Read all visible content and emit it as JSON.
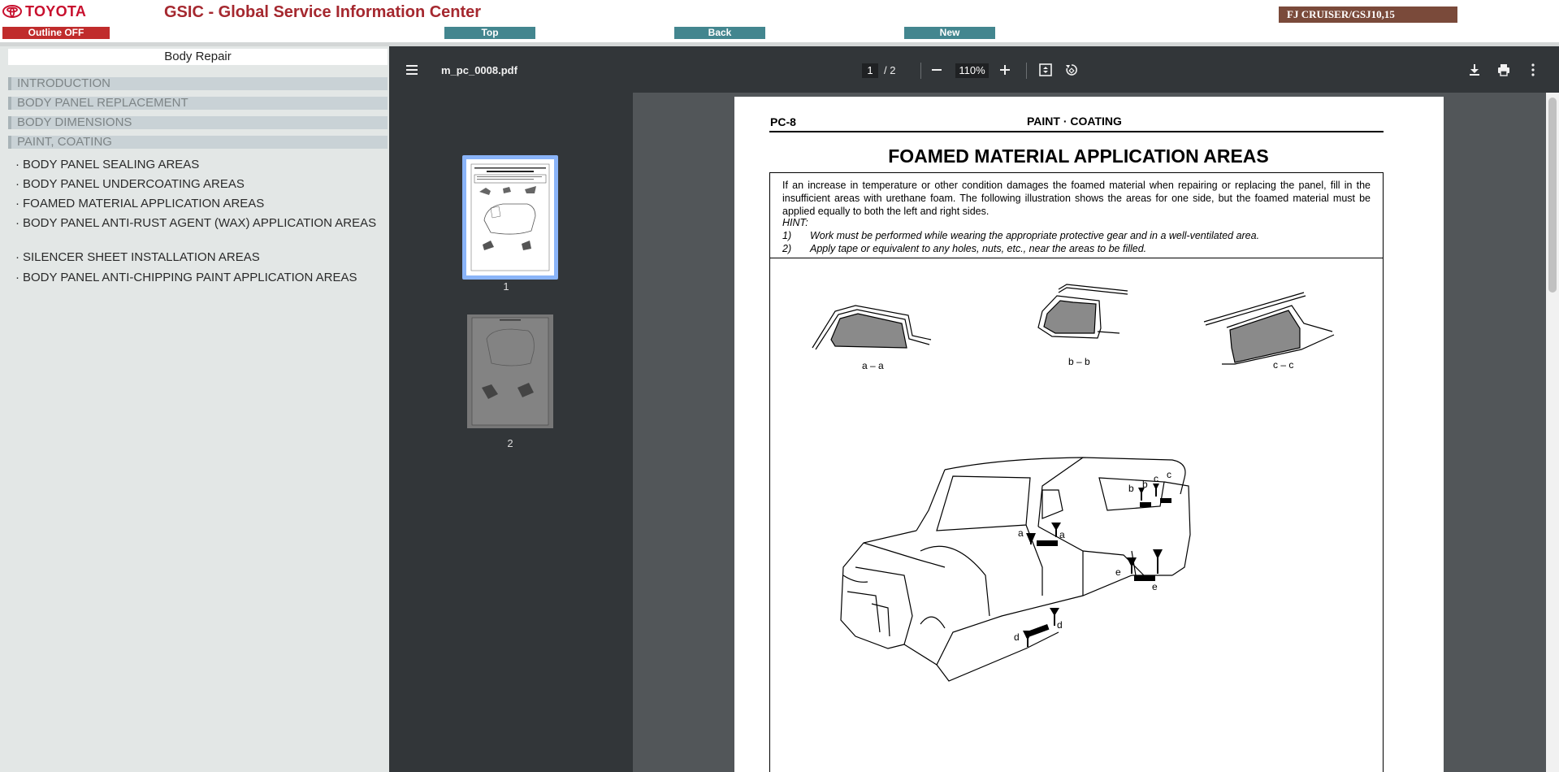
{
  "header": {
    "brand": "TOYOTA",
    "app_title": "GSIC - Global Service Information Center",
    "outline_button": "Outline OFF",
    "nav": {
      "top": "Top",
      "back": "Back",
      "new": "New"
    },
    "model": "FJ CRUISER/GSJ10,15"
  },
  "outline": {
    "section": "Body Repair",
    "categories": [
      "INTRODUCTION",
      "BODY PANEL REPLACEMENT",
      "BODY DIMENSIONS",
      "PAINT, COATING"
    ],
    "items": [
      "BODY PANEL SEALING AREAS",
      "BODY PANEL UNDERCOATING AREAS",
      "FOAMED MATERIAL APPLICATION AREAS",
      "BODY PANEL ANTI-RUST AGENT (WAX) APPLICATION AREAS",
      "SILENCER SHEET INSTALLATION AREAS",
      "BODY PANEL ANTI-CHIPPING PAINT APPLICATION AREAS"
    ],
    "bullet": "·"
  },
  "viewer": {
    "filename": "m_pc_0008.pdf",
    "page_current": "1",
    "page_total": "/ 2",
    "zoom": "110%",
    "thumb_labels": [
      "1",
      "2"
    ],
    "icons": [
      "menu-icon",
      "zoom-out-icon",
      "zoom-in-icon",
      "fit-page-icon",
      "rotate-icon",
      "download-icon",
      "print-icon",
      "more-icon"
    ]
  },
  "document": {
    "code": "PC-8",
    "header": "PAINT · COATING",
    "title": "FOAMED MATERIAL APPLICATION AREAS",
    "note": "If an increase in temperature or other condition damages the foamed material when repairing or replacing the panel, fill in the insufficient areas with urethane foam. The following illustration shows the areas for one side, but the foamed material must be applied equally to both the left and right sides.",
    "hint": "HINT:",
    "steps": [
      {
        "num": "1)",
        "text": "Work must be performed while wearing the appropriate protective gear and in a well-ventilated area."
      },
      {
        "num": "2)",
        "text": "Apply tape or equivalent to any holes, nuts, etc., near the areas to be filled."
      }
    ],
    "section_labels": [
      "a – a",
      "b – b",
      "c – c"
    ],
    "callouts": [
      "a",
      "a",
      "b",
      "b",
      "c",
      "c",
      "e",
      "e",
      "d",
      "d"
    ]
  },
  "colors": {
    "brand_red": "#c8102e",
    "title_red": "#a5282f",
    "nav_teal": "#43868f",
    "outline_red": "#c02c2c",
    "model_brown": "#7a4a3a",
    "viewer_dark": "#323639",
    "viewer_bg": "#525659",
    "thumb_sel": "#8ab4f8"
  }
}
